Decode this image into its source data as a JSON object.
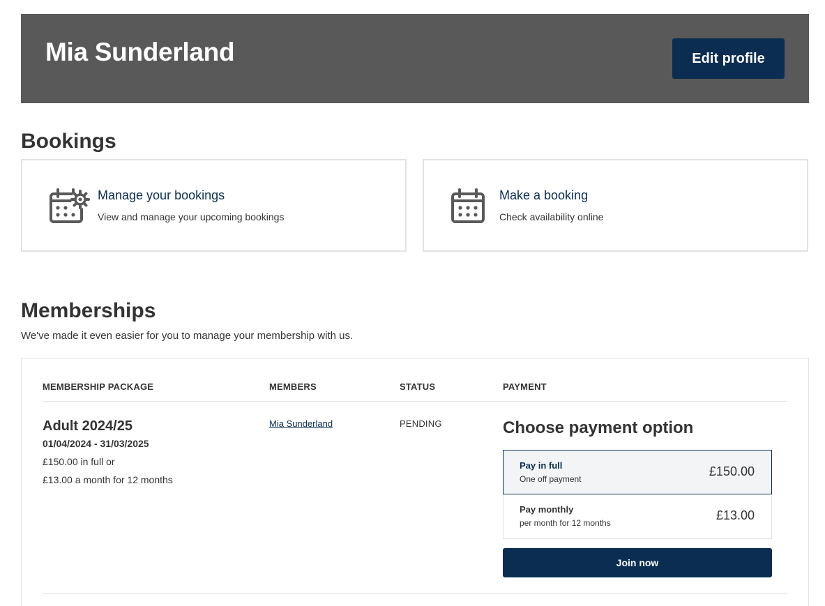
{
  "header": {
    "name": "Mia Sunderland",
    "edit_label": "Edit profile",
    "background_color": "#595959",
    "accent_color": "#0b2d52"
  },
  "bookings": {
    "title": "Bookings",
    "cards": [
      {
        "title": "Manage your bookings",
        "description": "View and manage your upcoming bookings",
        "icon": "calendar-gear-icon"
      },
      {
        "title": "Make a booking",
        "description": "Check availability online",
        "icon": "calendar-icon"
      }
    ]
  },
  "memberships": {
    "title": "Memberships",
    "intro": "We've made it even easier for you to manage your membership with us.",
    "columns": {
      "package": "MEMBERSHIP PACKAGE",
      "members": "MEMBERS",
      "status": "STATUS",
      "payment": "PAYMENT"
    },
    "row": {
      "package_name": "Adult 2024/25",
      "dates": "01/04/2024 - 31/03/2025",
      "price_full": "£150.00 in full or",
      "price_monthly": "£13.00 a month for 12 months",
      "member": "Mia Sunderland",
      "status": "PENDING",
      "payment": {
        "title": "Choose payment option",
        "options": [
          {
            "label": "Pay in full",
            "sublabel": "One off payment",
            "price": "£150.00",
            "selected": true
          },
          {
            "label": "Pay monthly",
            "sublabel": "per month for 12 months",
            "price": "£13.00",
            "selected": false
          }
        ],
        "join_label": "Join now"
      }
    }
  }
}
